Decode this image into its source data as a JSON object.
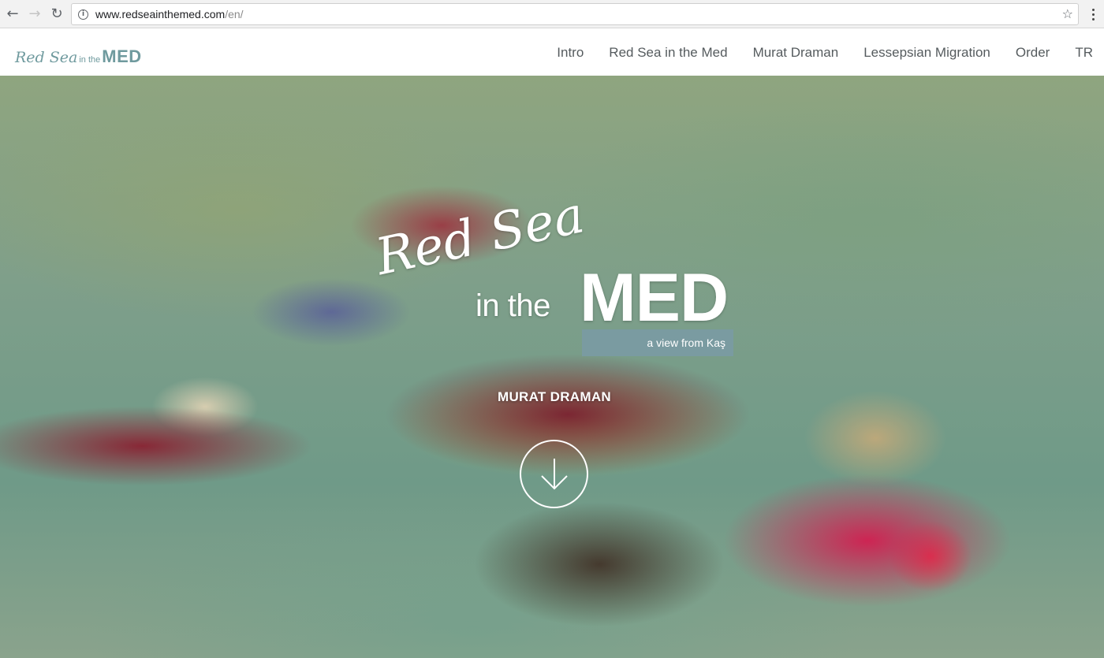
{
  "browser": {
    "url_domain": "www.redseainthemed.com",
    "url_path": "/en/",
    "icons": {
      "back": "back-arrow-icon",
      "forward": "forward-arrow-icon",
      "reload": "reload-icon",
      "info": "info-icon",
      "bookmark": "star-icon",
      "menu": "kebab-menu-icon"
    }
  },
  "site": {
    "logo": {
      "script": "Red Sea",
      "small": "in the",
      "caps": "MED"
    },
    "nav": [
      {
        "label": "Intro"
      },
      {
        "label": "Red Sea in the Med"
      },
      {
        "label": "Murat Draman"
      },
      {
        "label": "Lessepsian Migration"
      },
      {
        "label": "Order"
      },
      {
        "label": "TR"
      }
    ],
    "accent_color": "#6f9a9e"
  },
  "hero": {
    "title_script": "Red Sea",
    "title_in_the": "in the",
    "title_med": "MED",
    "subtitle": "a view from Kaş",
    "author": "MURAT DRAMAN",
    "scroll_icon": "arrow-down-circle-icon",
    "band_color": "#7a9ba1"
  }
}
